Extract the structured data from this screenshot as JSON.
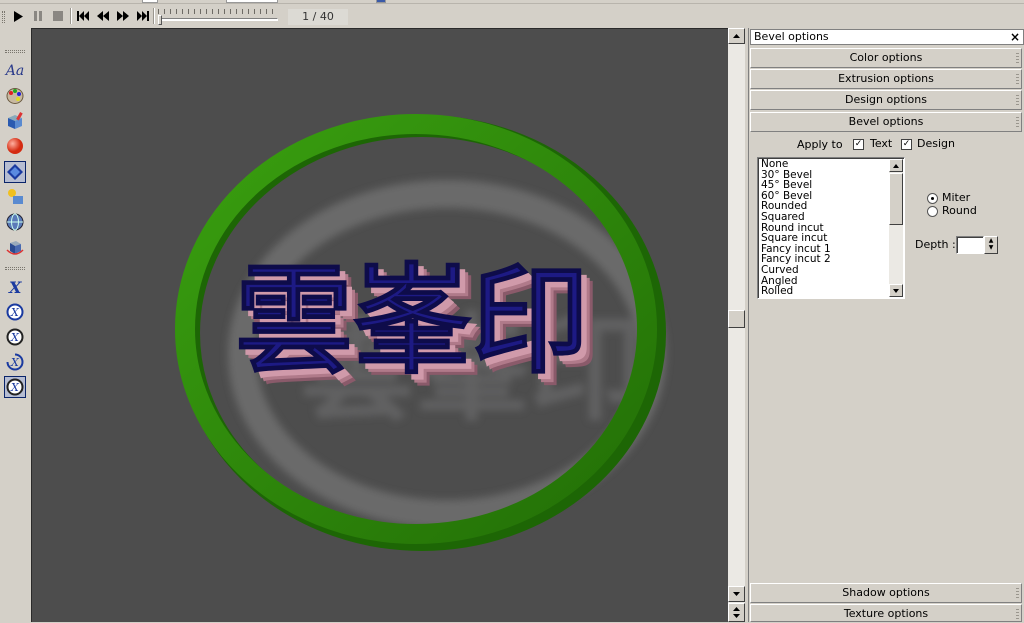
{
  "toolbar": {
    "play_icon": "play-icon",
    "pause_icon": "pause-icon",
    "stop_icon": "stop-icon",
    "first_icon": "skip-first-icon",
    "rewind_icon": "rewind-icon",
    "forward_icon": "fast-forward-icon",
    "last_icon": "skip-last-icon",
    "frame_counter": "1 / 40",
    "timeline_position": 0.0
  },
  "tools": [
    {
      "name": "text-tool",
      "label": "Aa"
    },
    {
      "name": "palette-icon"
    },
    {
      "name": "box-paint-icon"
    },
    {
      "name": "sphere-icon"
    },
    {
      "name": "bevel-tool-icon",
      "active": true
    },
    {
      "name": "shapes-icon"
    },
    {
      "name": "globe-icon"
    },
    {
      "name": "cube-rotate-icon"
    },
    {
      "name": "rotate-x-icon"
    },
    {
      "name": "rotate-x-circle-icon"
    },
    {
      "name": "rotate-x-circle-alt-icon"
    },
    {
      "name": "rotate-x-circle-3-icon"
    },
    {
      "name": "rotate-x-circle-4-icon",
      "active": true
    }
  ],
  "canvas": {
    "text": "雲峯印",
    "background": "#4d4d4d",
    "ring_color": "#2f8f0a",
    "text_face_color": "#1d1a84",
    "text_side_color": "#c98a9a"
  },
  "panel": {
    "title": "Bevel options",
    "close": "×",
    "sections": {
      "color": "Color options",
      "extrusion": "Extrusion options",
      "design": "Design options",
      "bevel": "Bevel options",
      "shadow": "Shadow options",
      "texture": "Texture options"
    },
    "apply_to": "Apply to",
    "apply_text": "Text",
    "apply_design": "Design",
    "bevel_list": [
      "None",
      "30° Bevel",
      "45° Bevel",
      "60° Bevel",
      "Rounded",
      "Squared",
      "Round incut",
      "Square incut",
      "Fancy incut 1",
      "Fancy incut 2",
      "Curved",
      "Angled",
      "Rolled"
    ],
    "miter": "Miter",
    "round": "Round",
    "depth_label": "Depth :",
    "depth_value": ""
  }
}
